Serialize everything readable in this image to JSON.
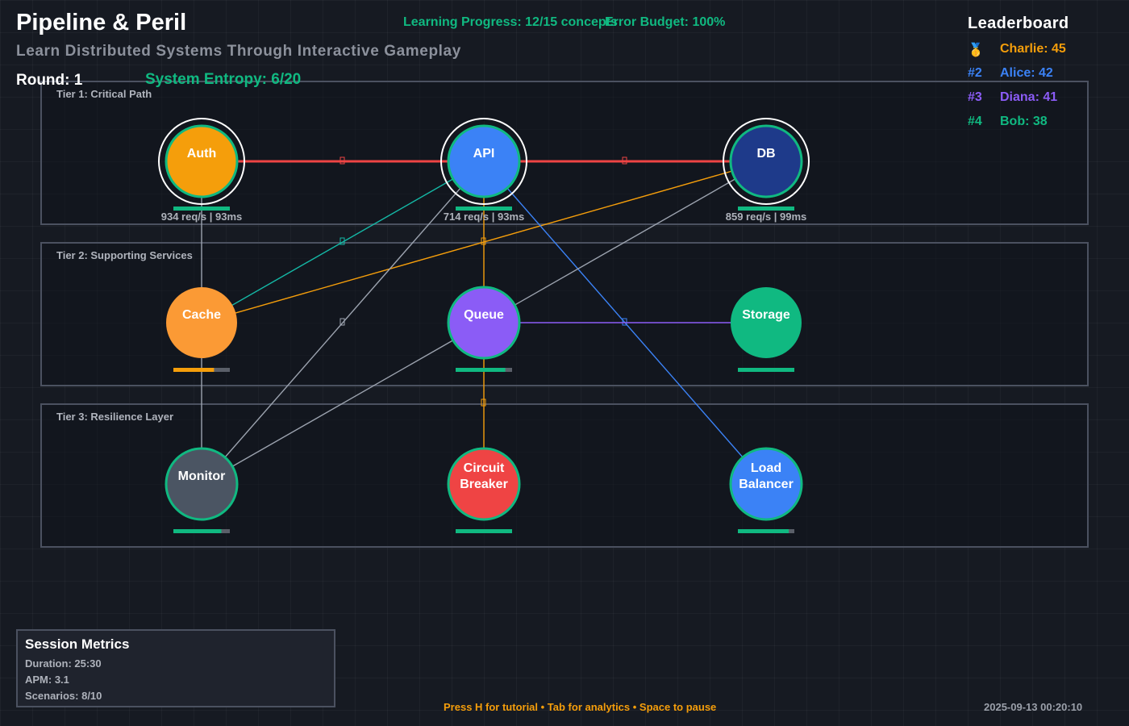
{
  "header": {
    "title": "Pipeline & Peril",
    "subtitle": "Learn Distributed Systems Through Interactive Gameplay",
    "round": "Round: 1",
    "entropy": "System Entropy: 6/20",
    "learning_progress": "Learning Progress: 12/15 concepts",
    "error_budget": "Error Budget: 100%"
  },
  "leaderboard": {
    "title": "Leaderboard",
    "entries": [
      {
        "rank": "🥇",
        "name": "Charlie: 45",
        "color": "#f59e0b"
      },
      {
        "rank": "#2",
        "name": "Alice: 42",
        "color": "#3b82f6"
      },
      {
        "rank": "#3",
        "name": "Diana: 41",
        "color": "#8b5cf6"
      },
      {
        "rank": "#4",
        "name": "Bob: 38",
        "color": "#10b981"
      }
    ]
  },
  "tiers": [
    {
      "label": "Tier 1: Critical Path"
    },
    {
      "label": "Tier 2: Supporting Services"
    },
    {
      "label": "Tier 3: Resilience Layer"
    }
  ],
  "nodes": [
    {
      "id": "auth",
      "label": [
        "Auth"
      ],
      "color": "#f59e0b",
      "ring": "#10b981",
      "critical": true,
      "health": 1.0,
      "bar_color": "#10b981",
      "stat": "934 req/s | 93ms"
    },
    {
      "id": "api",
      "label": [
        "API"
      ],
      "color": "#3b82f6",
      "ring": "#10b981",
      "critical": true,
      "health": 1.0,
      "bar_color": "#10b981",
      "stat": "714 req/s | 93ms"
    },
    {
      "id": "db",
      "label": [
        "DB"
      ],
      "color": "#1e3a8a",
      "ring": "#10b981",
      "critical": true,
      "health": 1.0,
      "bar_color": "#10b981",
      "stat": "859 req/s | 99ms"
    },
    {
      "id": "cache",
      "label": [
        "Cache"
      ],
      "color": "#fb9a35",
      "ring": null,
      "critical": false,
      "health": 0.72,
      "bar_color": "#f59e0b",
      "stat": ""
    },
    {
      "id": "queue",
      "label": [
        "Queue"
      ],
      "color": "#8b5cf6",
      "ring": "#10b981",
      "critical": false,
      "health": 0.88,
      "bar_color": "#10b981",
      "stat": ""
    },
    {
      "id": "storage",
      "label": [
        "Storage"
      ],
      "color": "#10b981",
      "ring": null,
      "critical": false,
      "health": 1.0,
      "bar_color": "#10b981",
      "stat": ""
    },
    {
      "id": "monitor",
      "label": [
        "Monitor"
      ],
      "color": "#4b5563",
      "ring": "#10b981",
      "critical": false,
      "health": 0.85,
      "bar_color": "#10b981",
      "stat": ""
    },
    {
      "id": "circuit-breaker",
      "label": [
        "Circuit",
        "Breaker"
      ],
      "color": "#ef4444",
      "ring": "#10b981",
      "critical": false,
      "health": 1.0,
      "bar_color": "#10b981",
      "stat": ""
    },
    {
      "id": "load-balancer",
      "label": [
        "Load",
        "Balancer"
      ],
      "color": "#3b82f6",
      "ring": "#10b981",
      "critical": false,
      "health": 0.9,
      "bar_color": "#10b981",
      "stat": ""
    }
  ],
  "connections": [
    {
      "from": "auth",
      "to": "api",
      "color": "#ef4444",
      "marker": true
    },
    {
      "from": "api",
      "to": "db",
      "color": "#ef4444",
      "marker": true
    },
    {
      "from": "cache",
      "to": "api",
      "color": "#14b8a6",
      "marker": true
    },
    {
      "from": "cache",
      "to": "db",
      "color": "#f59e0b",
      "marker": false
    },
    {
      "from": "api",
      "to": "queue",
      "color": "#f59e0b",
      "marker": true
    },
    {
      "from": "api",
      "to": "load-balancer",
      "color": "#3b82f6",
      "marker": true
    },
    {
      "from": "monitor",
      "to": "api",
      "color": "#9ca3af",
      "marker": true
    },
    {
      "from": "queue",
      "to": "db",
      "color": "#9ca3af",
      "marker": false
    },
    {
      "from": "queue",
      "to": "storage",
      "color": "#8b5cf6",
      "marker": false
    },
    {
      "from": "queue",
      "to": "circuit-breaker",
      "color": "#f59e0b",
      "marker": true
    },
    {
      "from": "auth",
      "to": "monitor",
      "color": "#9ca3af",
      "marker": false
    },
    {
      "from": "monitor",
      "to": "queue",
      "color": "#9ca3af",
      "marker": false
    }
  ],
  "session_metrics": {
    "title": "Session Metrics",
    "duration": "Duration: 25:30",
    "apm": "APM: 3.1",
    "scenarios": "Scenarios: 8/10"
  },
  "footer": {
    "hint": "Press H for tutorial • Tab for analytics • Space to pause",
    "timestamp": "2025-09-13 00:20:10"
  }
}
